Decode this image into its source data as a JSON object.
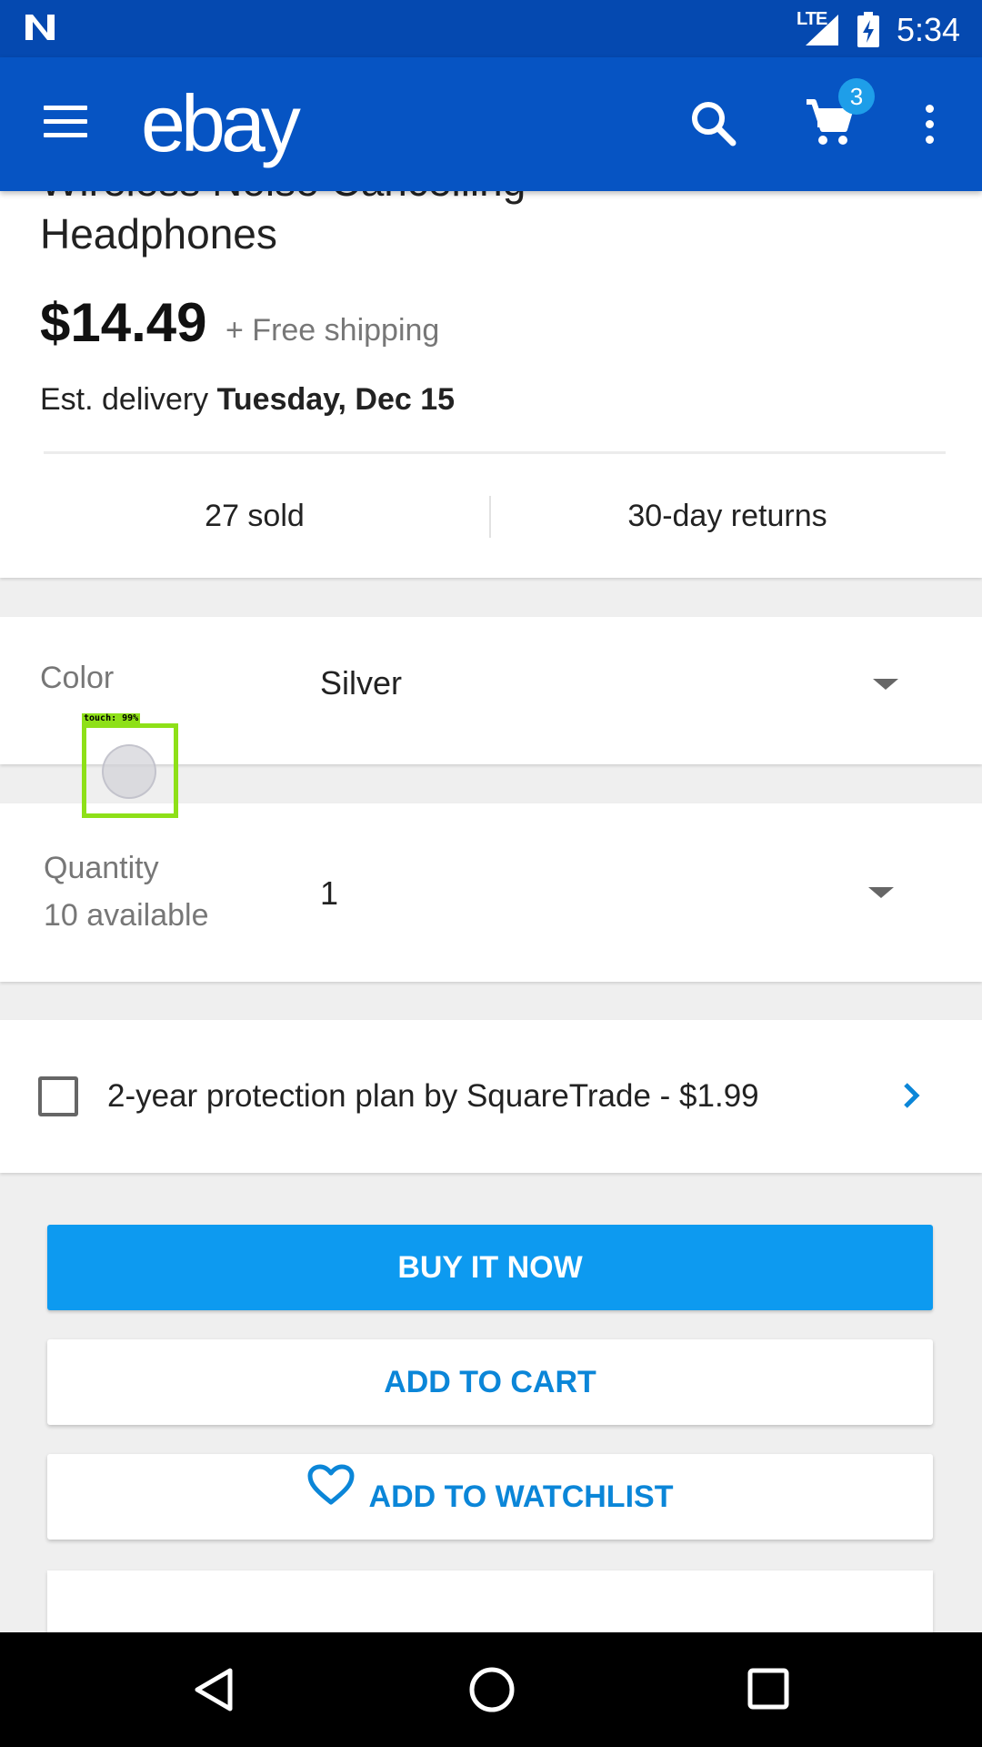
{
  "status_bar": {
    "network": "LTE",
    "time": "5:34"
  },
  "app_bar": {
    "logo": "ebay",
    "cart_count": "3"
  },
  "product": {
    "title_partial": "Wireless Noise Cancelling",
    "title": "Headphones",
    "price": "$14.49",
    "shipping": "+ Free shipping",
    "delivery_prefix": "Est. delivery",
    "delivery_date": "Tuesday, Dec 15",
    "sold": "27 sold",
    "returns": "30-day returns"
  },
  "options": {
    "color_label": "Color",
    "color_value": "Silver",
    "quantity_label": "Quantity",
    "quantity_available": "10 available",
    "quantity_value": "1"
  },
  "touch_overlay": {
    "label": "touch: 99%"
  },
  "protection": {
    "text": "2-year protection plan by SquareTrade - $1.99"
  },
  "actions": {
    "buy_now": "BUY IT NOW",
    "add_to_cart": "ADD TO CART",
    "add_to_watchlist": "ADD TO WATCHLIST"
  },
  "colors": {
    "status_bar": "#0549b0",
    "app_bar": "#0654c3",
    "primary_button": "#0d9af0",
    "link_blue": "#0b86d8",
    "touch_highlight": "#8ee018"
  }
}
